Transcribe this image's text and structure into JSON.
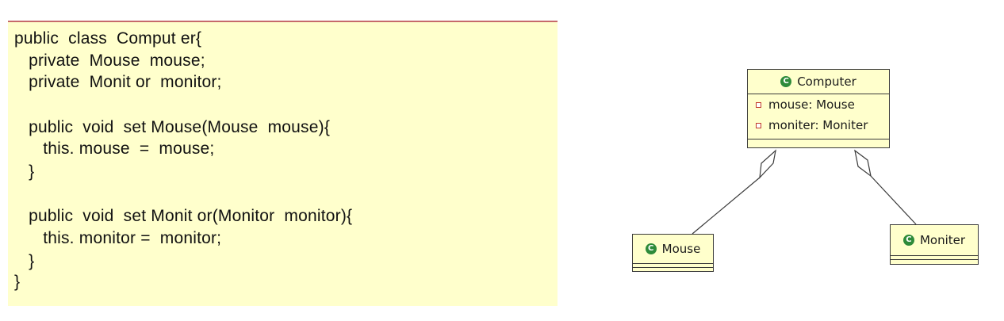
{
  "code": {
    "lines": [
      "public  class  Comput er{",
      "   private  Mouse  mouse;",
      "   private  Monit or  monitor;",
      "   public  void  set Mouse(Mouse  mouse){",
      "      this. mouse  =  mouse;",
      "   }",
      "   public  void  set Monit or(Monitor  monitor){",
      "      this. monitor =  monitor;",
      "   }",
      "}"
    ]
  },
  "uml": {
    "badge_letter": "C",
    "computer": {
      "name": "Computer",
      "fields": [
        "mouse: Mouse",
        "moniter: Moniter"
      ]
    },
    "mouse": {
      "name": "Mouse"
    },
    "moniter": {
      "name": "Moniter"
    }
  },
  "colors": {
    "note_fill": "#ffffcc",
    "note_border": "#c66a6a",
    "class_badge": "#2e8b3a",
    "private_marker": "#c0392b"
  }
}
